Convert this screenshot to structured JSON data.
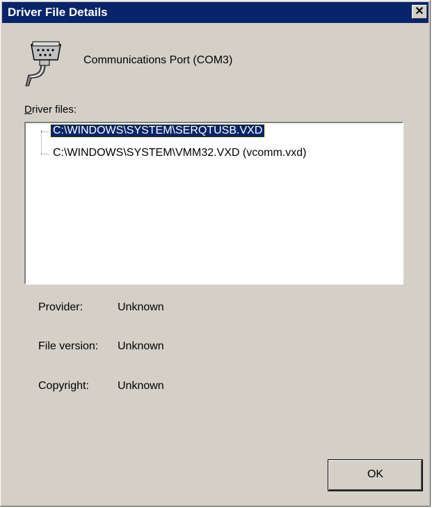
{
  "window": {
    "title": "Driver File Details",
    "close_symbol": "✕"
  },
  "device": {
    "icon": "serial-port-icon",
    "name": "Communications Port (COM3)"
  },
  "driver_files": {
    "label_prefix": "D",
    "label_rest": "river files:",
    "items": [
      {
        "path": "C:\\WINDOWS\\SYSTEM\\SERQTUSB.VXD",
        "selected": true
      },
      {
        "path": "C:\\WINDOWS\\SYSTEM\\VMM32.VXD (vcomm.vxd)",
        "selected": false
      }
    ]
  },
  "details": {
    "provider_label": "Provider:",
    "provider_value": "Unknown",
    "version_label": "File version:",
    "version_value": "Unknown",
    "copyright_label": "Copyright:",
    "copyright_value": "Unknown"
  },
  "buttons": {
    "ok_label": "OK"
  },
  "colors": {
    "titlebar": "#08246b",
    "dialog_face": "#d4d0c8",
    "selection": "#0a246a"
  }
}
